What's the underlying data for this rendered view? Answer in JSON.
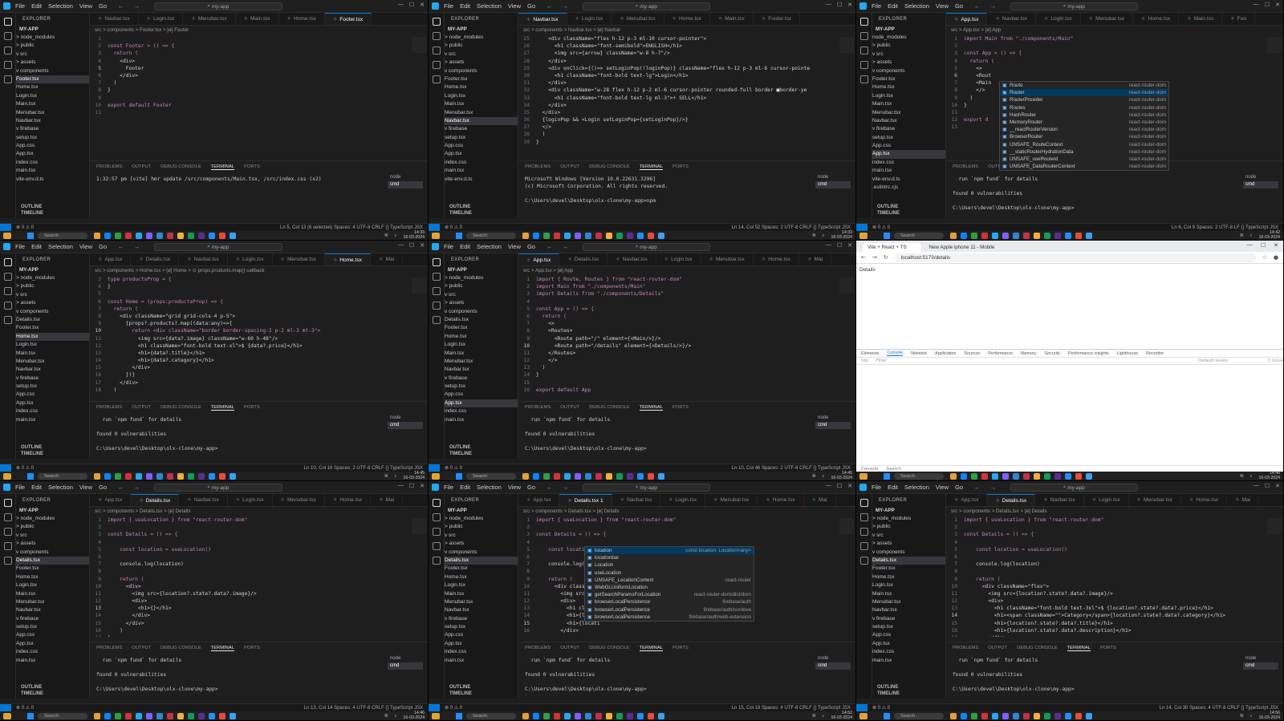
{
  "menu": {
    "items": [
      "File",
      "Edit",
      "Selection",
      "View",
      "Go"
    ],
    "search": "my-app"
  },
  "explorer": {
    "header": "EXPLORER",
    "project": "MY-APP",
    "outline": "OUTLINE",
    "timeline": "TIMELINE"
  },
  "panel_tabs": [
    "PROBLEMS",
    "OUTPUT",
    "DEBUG CONSOLE",
    "TERMINAL",
    "PORTS"
  ],
  "terminal_list": [
    "node",
    "cmd"
  ],
  "taskbar": {
    "search": "Search",
    "lang": "ENG\nIN"
  },
  "cells": [
    {
      "tabs": [
        "Navbar.tsx",
        "Login.tsx",
        "Menubar.tsx",
        "Main.tsx",
        "Home.tsx",
        "Footer.tsx"
      ],
      "active_tab": 5,
      "breadcrumb": "src > components > Footer.tsx > [ø] Footer",
      "tree": [
        "> node_modules",
        "> public",
        "v src",
        "  > assets",
        "  v components",
        "     Footer.tsx",
        "     Home.tsx",
        "     Login.tsx",
        "     Main.tsx",
        "     Menubar.tsx",
        "     Navbar.tsx",
        "  v firebase",
        "     setup.tsx",
        "   App.css",
        "   App.tsx",
        "   index.css",
        "   main.tsx",
        "   vite-env.d.ts"
      ],
      "selected": 5,
      "code_start": 1,
      "current_line": 5,
      "code": [
        "",
        "const Footer = () => {",
        "  return (",
        "    <div>",
        "      Footer",
        "    </div>",
        "  )",
        "}",
        "",
        "export default Footer",
        ""
      ],
      "terminal": [
        "1:32:57 pm [vite] hmr update /src/components/Main.tsx, /src/index.css (x2)",
        ""
      ],
      "status": "Ln 5, Col 13 (6 selected)   Spaces: 4   UTF-8   CRLF   {} TypeScript JSX",
      "clock": "14:33\n16-03-2024"
    },
    {
      "tabs": [
        "Navbar.tsx",
        "Login.tsx",
        "Menubar.tsx",
        "Home.tsx",
        "Main.tsx",
        "Footer.tsx"
      ],
      "active_tab": 0,
      "breadcrumb": "src > components > Navbar.tsx > [ø] Navbar",
      "tree": [
        "> node_modules",
        "> public",
        "v src",
        "  > assets",
        "  v components",
        "     Footer.tsx",
        "     Home.tsx",
        "     Login.tsx",
        "     Main.tsx",
        "     Menubar.tsx",
        "     Navbar.tsx",
        "  v firebase",
        "     setup.tsx",
        "   App.css",
        "   App.tsx",
        "   index.css",
        "   main.tsx",
        "   vite-env.d.ts"
      ],
      "selected": 10,
      "code_start": 25,
      "current_line": 0,
      "code": [
        "    <div className=\"flex h-12 p-3 ml-10 cursor-pointer\">",
        "      <h1 className=\"font-semibold\">ENGLISH</h1>",
        "      <img src={arrow} className=\"w-8 h-7\"/>",
        "    </div>",
        "    <div onClick={()=> setLoginPop(!loginPop)} className=\"flex h-12 p-3 ml-6 cursor-pointe",
        "      <h1 className=\"font-bold text-lg\">Login</h1>",
        "    </div>",
        "    <div className=\"w-28 flex h-12 p-2 ml-6 cursor-pointer rounded-full border ■border-ye",
        "      <h1 className=\"font-bold text-lg ml-3\">+ SELL</h1>",
        "    </div>",
        "  </div>",
        "  {loginPop && <Login setLoginPop={setLoginPop}/>}",
        "  </>",
        "  )",
        "}"
      ],
      "terminal": [
        "Microsoft Windows [Version 10.0.22631.3296]",
        "(c) Microsoft Corporation. All rights reserved.",
        "",
        "C:\\Users\\devel\\Desktop\\olx-clone\\my-app>npm "
      ],
      "status": "Ln 14, Col 52   Spaces: 2   UTF-8   CRLF   {} TypeScript JSX",
      "clock": "14:33\n16-03-2024"
    },
    {
      "tabs": [
        "App.tsx",
        "Navbar.tsx",
        "Login.tsx",
        "Menubar.tsx",
        "Home.tsx",
        "Main.tsx",
        "Foo"
      ],
      "active_tab": 0,
      "breadcrumb": "src > App.tsx > [ø] App",
      "tree": [
        "  node_modules",
        "> public",
        "v src",
        "  > assets",
        "  v components",
        "     Footer.tsx",
        "     Home.tsx",
        "     Login.tsx",
        "     Main.tsx",
        "     Menubar.tsx",
        "     Navbar.tsx",
        "  v firebase",
        "     setup.tsx",
        "   App.css",
        "   App.tsx",
        "   index.css",
        "   main.tsx",
        "   vite-env.d.ts",
        "   .eslintrc.cjs"
      ],
      "selected": 14,
      "code_start": 1,
      "current_line": 6,
      "code": [
        "import Main from \"./components/Main\"",
        "",
        "const App = () => {",
        "  return (",
        "    <>",
        "    <Rout",
        "    <Main",
        "    </>",
        "  )",
        "}",
        "",
        "export d",
        ""
      ],
      "terminal": [
        "  run `npm fund` for details",
        "",
        "found 0 vulnerabilities",
        "",
        "C:\\Users\\devel\\Desktop\\olx-clone\\my-app>"
      ],
      "status": "Ln 6, Col 9   Spaces: 2   UTF-8   LF   {} TypeScript JSX",
      "clock": "14:42\n16-03-2024"
    },
    {
      "tabs": [
        "App.tsx",
        "Details.tsx",
        "Navbar.tsx",
        "Login.tsx",
        "Menubar.tsx",
        "Home.tsx",
        "Mai"
      ],
      "active_tab": 5,
      "breadcrumb": "src > components > Home.tsx > [ø] Home > ⊙ props.products.map() callback",
      "tree": [
        "> node_modules",
        "> public",
        "v src",
        "  > assets",
        "  v components",
        "     Details.tsx",
        "     Footer.tsx",
        "     Home.tsx",
        "     Login.tsx",
        "     Main.tsx",
        "     Menubar.tsx",
        "     Navbar.tsx",
        "  v firebase",
        "     setup.tsx",
        "   App.css",
        "   App.tsx",
        "   index.css",
        "   main.tsx"
      ],
      "selected": 7,
      "code_start": 3,
      "current_line": 10,
      "code": [
        "type productsProp = {",
        "}",
        "",
        "const Home = (props:productsProp) => {",
        "  return (",
        "    <div className=\"grid grid-cols-4 p-5\">",
        "      {props?.products?.map((data:any)=>{",
        "        return <div className=\"border border-spacing-1 p-2 ml-3 mt-3\">",
        "          <img src={data?.image} className=\"w-60 h-48\"/>",
        "          <h1 className=\"font-bold text-xl\">$ {data?.price}</h1>",
        "          <h1>{data?.title}</h1>",
        "          <h1>{data?.category}</h1>",
        "        </div>",
        "      })}",
        "    </div>",
        "  )"
      ],
      "terminal": [
        "  run `npm fund` for details",
        "",
        "found 0 vulnerabilities",
        "",
        "C:\\Users\\devel\\Desktop\\olx-clone\\my-app>"
      ],
      "status": "Ln 10, Col 16   Spaces: 2   UTF-8   CRLF   {} TypeScript JSX",
      "clock": "14:45\n16-03-2024"
    },
    {
      "tabs": [
        "App.tsx",
        "Details.tsx",
        "Navbar.tsx",
        "Login.tsx",
        "Menubar.tsx",
        "Home.tsx",
        "Mai"
      ],
      "active_tab": 0,
      "breadcrumb": "src > App.tsx > [ø] App",
      "tree": [
        "> node_modules",
        "> public",
        "v src",
        "  > assets",
        "  v components",
        "     Details.tsx",
        "     Footer.tsx",
        "     Home.tsx",
        "     Login.tsx",
        "     Main.tsx",
        "     Menubar.tsx",
        "     Navbar.tsx",
        "  v firebase",
        "     setup.tsx",
        "   App.css",
        "   App.tsx",
        "   index.css",
        "   main.tsx"
      ],
      "selected": 15,
      "code_start": 1,
      "current_line": 10,
      "code": [
        "import { Route, Routes } from \"react-router-dom\"",
        "import Main from \"./components/Main\"",
        "import Details from \"./components/Details\"",
        "",
        "const App = () => {",
        "  return (",
        "    <>",
        "    <Routes>",
        "      <Route path=\"/\" element={<Main/>}/>",
        "      <Route path=\"/details\" element={<Details/>}/>",
        "    </Routes>",
        "    </>",
        "  )",
        "}",
        "",
        "export default App"
      ],
      "terminal": [
        "  run `npm fund` for details",
        "",
        "found 0 vulnerabilities",
        "",
        "C:\\Users\\devel\\Desktop\\olx-clone\\my-app>"
      ],
      "status": "Ln 10, Col 46   Spaces: 2   UTF-8   CRLF   {} TypeScript JSX",
      "clock": "14:45\n16-03-2024"
    },
    {
      "browser": true,
      "tabs": [
        "Vite + React + TS",
        "New Apple iphone 11 - Mobile"
      ],
      "url": "localhost:5173/details",
      "page_text": "Details",
      "devtools_tabs": [
        "Elements",
        "Console",
        "Network",
        "Application",
        "Sources",
        "Performance",
        "Memory",
        "Security",
        "Performance insights",
        "Lighthouse",
        "Recorder"
      ],
      "filter": "Filter",
      "top": "top",
      "levels": "Default levels",
      "issues": "1 Issue",
      "drawer": [
        "Console",
        "Search"
      ],
      "clock": "14:48\n16-03-2024"
    },
    {
      "tabs": [
        "App.tsx",
        "Details.tsx",
        "Navbar.tsx",
        "Login.tsx",
        "Menubar.tsx",
        "Home.tsx",
        "Mai"
      ],
      "active_tab": 1,
      "breadcrumb": "src > components > Details.tsx > [ø] Details",
      "tree": [
        "> node_modules",
        "> public",
        "v src",
        "  > assets",
        "  v components",
        "     Details.tsx",
        "     Footer.tsx",
        "     Home.tsx",
        "     Login.tsx",
        "     Main.tsx",
        "     Menubar.tsx",
        "     Navbar.tsx",
        "  v firebase",
        "     setup.tsx",
        "   App.css",
        "   App.tsx",
        "   index.css",
        "   main.tsx"
      ],
      "selected": 5,
      "code_start": 1,
      "current_line": 13,
      "code": [
        "import { useLocation } from \"react-router-dom\"",
        "",
        "const Details = () => {",
        "",
        "    const location = useLocation()",
        "",
        "    console.log(location)",
        "",
        "    return (",
        "      <div>",
        "        <img src={location?.state?.data?.image}/>",
        "        <div>",
        "          <h1>{}</h1>",
        "        </div>",
        "      </div>",
        "    )",
        "}"
      ],
      "terminal": [
        "  run `npm fund` for details",
        "",
        "found 0 vulnerabilities",
        "",
        "C:\\Users\\devel\\Desktop\\olx-clone\\my-app>"
      ],
      "status": "Ln 13, Col 14   Spaces: 4   UTF-8   CRLF   {} TypeScript JSX",
      "clock": "14:46\n16-03-2024"
    },
    {
      "tabs": [
        "App.tsx",
        "Details.tsx 1",
        "Navbar.tsx",
        "Login.tsx",
        "Menubar.tsx",
        "Home.tsx",
        "Mai"
      ],
      "active_tab": 1,
      "breadcrumb": "src > components > Details.tsx > [ø] Details",
      "tree": [
        "> node_modules",
        "> public",
        "v src",
        "  > assets",
        "  v components",
        "     Details.tsx",
        "     Footer.tsx",
        "     Home.tsx",
        "     Login.tsx",
        "     Main.tsx",
        "     Menubar.tsx",
        "     Navbar.tsx",
        "  v firebase",
        "     setup.tsx",
        "   App.css",
        "   App.tsx",
        "   index.css",
        "   main.tsx"
      ],
      "selected": 5,
      "code_start": 1,
      "current_line": 15,
      "code": [
        "import { useLocation } from \"react-router-dom\"",
        "",
        "const Details = () => {",
        "",
        "    const location",
        "",
        "    console.log(lo",
        "",
        "    return (",
        "      <div className",
        "        <img src={loca",
        "        <div>",
        "          <h1 classN",
        "          <h1>{locat",
        "          <h1>{locati",
        "        </div>"
      ],
      "terminal": [
        "  run `npm fund` for details",
        "",
        "found 0 vulnerabilities",
        "",
        "C:\\Users\\devel\\Desktop\\olx-clone\\my-app>"
      ],
      "status": "Ln 15, Col 19   Spaces: 4   UTF-8   CRLF   {} TypeScript JSX",
      "clock": "14:52\n16-03-2024"
    },
    {
      "tabs": [
        "App.tsx",
        "Details.tsx",
        "Navbar.tsx",
        "Login.tsx",
        "Menubar.tsx",
        "Home.tsx",
        "Mai"
      ],
      "active_tab": 1,
      "breadcrumb": "src > components > Details.tsx > [ø] Details",
      "tree": [
        "> node_modules",
        "> public",
        "v src",
        "  > assets",
        "  v components",
        "     Details.tsx",
        "     Footer.tsx",
        "     Home.tsx",
        "     Login.tsx",
        "     Main.tsx",
        "     Menubar.tsx",
        "     Navbar.tsx",
        "  v firebase",
        "     setup.tsx",
        "   App.css",
        "   App.tsx",
        "   index.css",
        "   main.tsx"
      ],
      "selected": 5,
      "code_start": 1,
      "current_line": 14,
      "code": [
        "import { useLocation } from \"react-router-dom\"",
        "",
        "const Details = () => {",
        "",
        "    const location = useLocation()",
        "",
        "    console.log(location)",
        "",
        "    return (",
        "      <div className=\"flex\">",
        "        <img src={location?.state?.data?.image}/>",
        "        <div>",
        "          <h1 className=\"font-bold text-3xl\">$ {location?.state?.data?.price}</h1>",
        "          <h1><span className=\"\">Category</span>{location?.state?.data?.category}</h1>",
        "          <h1>{location?.state?.data?.title}</h1>",
        "          <h1>{location?.state?.data?.description}</h1>",
        "        </div>"
      ],
      "terminal": [
        "  run `npm fund` for details",
        "",
        "found 0 vulnerabilities",
        "",
        "C:\\Users\\devel\\Desktop\\olx-clone\\my-app>"
      ],
      "status": "Ln 14, Col 30   Spaces: 4   UTF-8   CRLF   {} TypeScript JSX",
      "clock": "14:56\n16-03-2024"
    }
  ],
  "autocomplete_router": {
    "items": [
      {
        "label": "Route",
        "src": "react-router-dom"
      },
      {
        "label": "Router",
        "src": "react-router-dom"
      },
      {
        "label": "RouterProvider",
        "src": "react-router-dom"
      },
      {
        "label": "Routes",
        "src": "react-router-dom"
      },
      {
        "label": "HashRouter",
        "src": "react-router-dom"
      },
      {
        "label": "MemoryRouter",
        "src": "react-router-dom"
      },
      {
        "label": "__reactRouterVersion",
        "src": "react-router-dom"
      },
      {
        "label": "BrowserRouter",
        "src": "react-router-dom"
      },
      {
        "label": "UNSAFE_RouteContext",
        "src": "react-router-dom"
      },
      {
        "label": "__staticRouterHydrationData",
        "src": "react-router-dom"
      },
      {
        "label": "UNSAFE_useRouteId",
        "src": "react-router-dom"
      },
      {
        "label": "UNSAFE_DataRouterContext",
        "src": "react-router-dom"
      }
    ],
    "selected": 1
  },
  "autocomplete_location": {
    "items": [
      {
        "label": "location",
        "src": "const location: Location<any>"
      },
      {
        "label": "locationbar",
        "src": ""
      },
      {
        "label": "Location",
        "src": ""
      },
      {
        "label": "useLocation",
        "src": ""
      },
      {
        "label": "UNSAFE_LocationContext",
        "src": "react-router"
      },
      {
        "label": "WebGLUniformLocation",
        "src": ""
      },
      {
        "label": "getSearchParamsForLocation",
        "src": "react-router-dom/dist/dom"
      },
      {
        "label": "browserLocalPersistence",
        "src": "firebase/auth"
      },
      {
        "label": "browserLocalPersistence",
        "src": "firebase/auth/cordova"
      },
      {
        "label": "browserLocalPersistence",
        "src": "firebase/auth/web-extension"
      }
    ],
    "selected": 0
  }
}
